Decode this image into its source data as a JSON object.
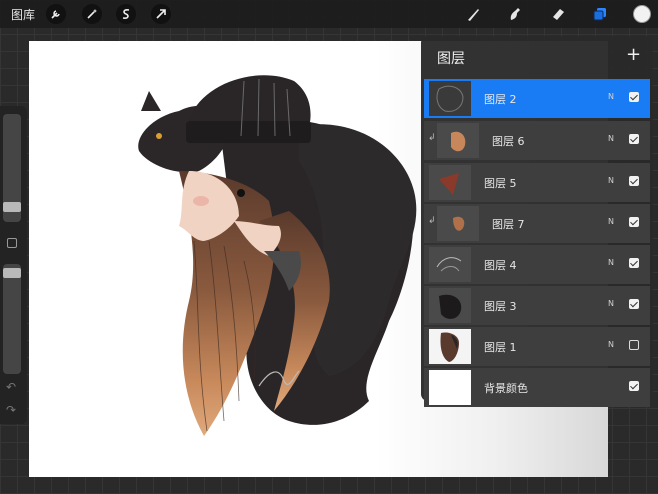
{
  "app": {
    "gallery_label": "图库"
  },
  "toolbar": {
    "left_tools": [
      "wrench-icon",
      "magic-wand-icon",
      "selection-icon",
      "transform-arrow-icon"
    ],
    "right_tools": [
      "brush-icon",
      "smudge-icon",
      "eraser-icon",
      "layers-icon"
    ],
    "active_tool": "layers-icon",
    "current_color": "#f2f2f2"
  },
  "sidebar": {
    "brush_size_level": 0.8,
    "opacity_level": 0.05
  },
  "layers_panel": {
    "title": "图层",
    "add_glyph": "+",
    "layers": [
      {
        "name": "图层 2",
        "blend": "N",
        "visible": true,
        "active": true,
        "clipped": false
      },
      {
        "name": "图层 6",
        "blend": "N",
        "visible": true,
        "active": false,
        "clipped": true
      },
      {
        "name": "图层 5",
        "blend": "N",
        "visible": true,
        "active": false,
        "clipped": false
      },
      {
        "name": "图层 7",
        "blend": "N",
        "visible": true,
        "active": false,
        "clipped": true
      },
      {
        "name": "图层 4",
        "blend": "N",
        "visible": true,
        "active": false,
        "clipped": false
      },
      {
        "name": "图层 3",
        "blend": "N",
        "visible": true,
        "active": false,
        "clipped": false
      },
      {
        "name": "图层 1",
        "blend": "N",
        "visible": false,
        "active": false,
        "clipped": false
      }
    ],
    "background": {
      "name": "背景颜色",
      "visible": true
    }
  },
  "colors": {
    "accent": "#1a7cf5",
    "hair_dark": "#2a2628",
    "hair_light": "#c8875a",
    "skin": "#f1d3c4"
  }
}
